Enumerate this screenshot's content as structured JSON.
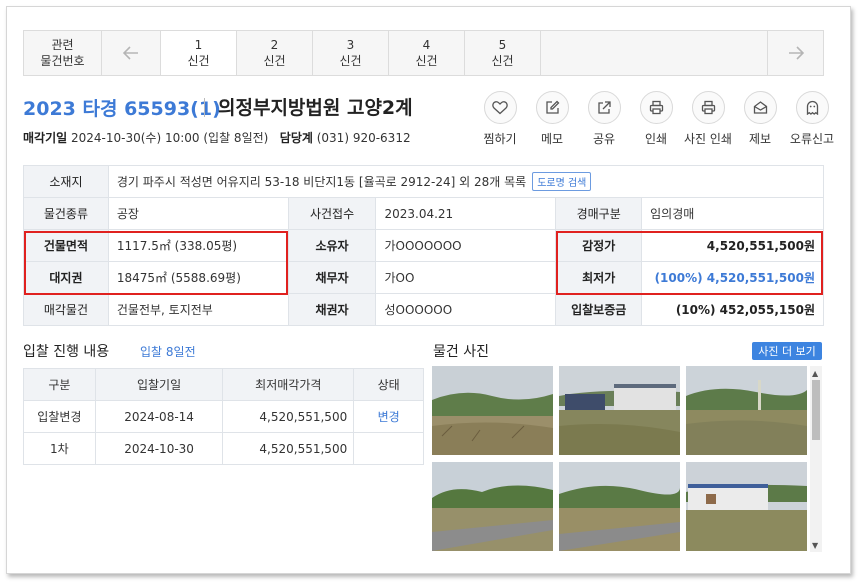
{
  "tabs": {
    "related_line1": "관련",
    "related_line2": "물건번호",
    "prev_icon": "arrow-left-icon",
    "next_icon": "arrow-right-icon",
    "items": [
      {
        "num": "1",
        "label": "신건"
      },
      {
        "num": "2",
        "label": "신건"
      },
      {
        "num": "3",
        "label": "신건"
      },
      {
        "num": "4",
        "label": "신건"
      },
      {
        "num": "5",
        "label": "신건"
      }
    ]
  },
  "header": {
    "case_number": "2023 타경 65593(1)",
    "court": "의정부지방법원 고양2계",
    "sale_date_label": "매각기일",
    "sale_date_value": "2024-10-30(수) 10:00 (입찰 8일전)",
    "dept_label": "담당계",
    "dept_value": "(031) 920-6312"
  },
  "actions": [
    {
      "icon": "heart-icon",
      "label": "찜하기"
    },
    {
      "icon": "edit-icon",
      "label": "메모"
    },
    {
      "icon": "share-icon",
      "label": "공유"
    },
    {
      "icon": "printer-icon",
      "label": "인쇄"
    },
    {
      "icon": "printer-icon",
      "label": "사진 인쇄"
    },
    {
      "icon": "envelope-icon",
      "label": "제보"
    },
    {
      "icon": "ghost-icon",
      "label": "오류신고"
    }
  ],
  "info": {
    "location_label": "소재지",
    "location_value": "경기 파주시 적성면 어유지리 53-18 비단지1동 [율곡로 2912-24] 외 28개 목록",
    "road_search": "도로명 검색",
    "type_label": "물건종류",
    "type_value": "공장",
    "filed_label": "사건접수",
    "filed_value": "2023.04.21",
    "auction_type_label": "경매구분",
    "auction_type_value": "임의경매",
    "building_area_label": "건물면적",
    "building_area_value": "1117.5㎡ (338.05평)",
    "owner_label": "소유자",
    "owner_value": "가OOOOOOO",
    "appraisal_label": "감정가",
    "appraisal_value": "4,520,551,500원",
    "land_label": "대지권",
    "land_value": "18475㎡ (5588.69평)",
    "debtor_label": "채무자",
    "debtor_value": "가OO",
    "min_price_label": "최저가",
    "min_price_value": "(100%) 4,520,551,500원",
    "sale_items_label": "매각물건",
    "sale_items_value": "건물전부, 토지전부",
    "creditor_label": "채권자",
    "creditor_value": "성OOOOOO",
    "deposit_label": "입찰보증금",
    "deposit_value": "(10%) 452,055,150원"
  },
  "bidding": {
    "title": "입찰 진행 내용",
    "subtitle": "입찰 8일전",
    "headers": [
      "구분",
      "입찰기일",
      "최저매각가격",
      "상태"
    ],
    "rows": [
      {
        "kind": "입찰변경",
        "date": "2024-08-14",
        "price": "4,520,551,500",
        "status": "변경"
      },
      {
        "kind": "1차",
        "date": "2024-10-30",
        "price": "4,520,551,500",
        "status": ""
      }
    ]
  },
  "photos": {
    "title": "물건 사진",
    "more_button": "사진 더 보기"
  },
  "colors": {
    "accent": "#3d7ad6",
    "highlight_border": "#e0211f",
    "label_bg": "#f1f3f6",
    "button_bg": "#3d84e0"
  }
}
